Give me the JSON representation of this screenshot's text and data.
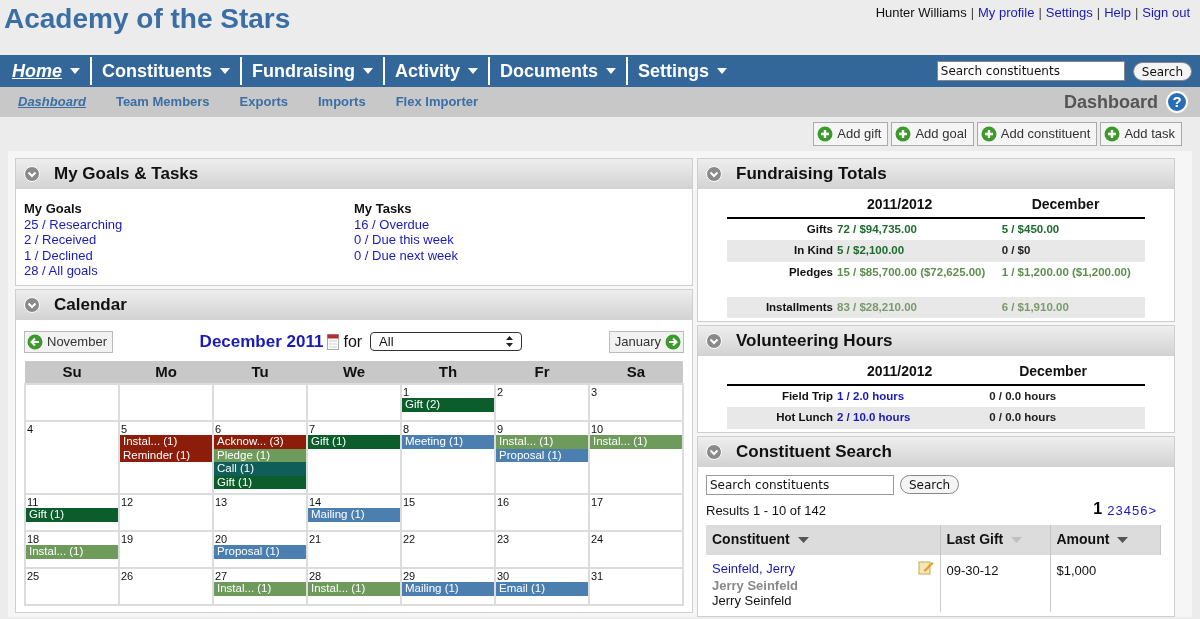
{
  "site_title": "Academy of the Stars",
  "user_bar": [
    {
      "kind": "text",
      "text": "Hunter Williams"
    },
    {
      "kind": "separator",
      "text": "|"
    },
    {
      "kind": "link",
      "text": "My profile"
    },
    {
      "kind": "separator",
      "text": "|"
    },
    {
      "kind": "link",
      "text": "Settings"
    },
    {
      "kind": "separator",
      "text": "|"
    },
    {
      "kind": "link",
      "text": "Help"
    },
    {
      "kind": "separator",
      "text": "|"
    },
    {
      "kind": "link",
      "text": "Sign out"
    }
  ],
  "nav": [
    {
      "label": "Home",
      "selected": true
    },
    {
      "label": "Constituents",
      "selected": false
    },
    {
      "label": "Fundraising",
      "selected": false
    },
    {
      "label": "Activity",
      "selected": false
    },
    {
      "label": "Documents",
      "selected": false
    },
    {
      "label": "Settings",
      "selected": false
    }
  ],
  "nav_search": {
    "value": "Search constituents",
    "button": "Search"
  },
  "subnav": [
    {
      "label": "Dashboard",
      "selected": true
    },
    {
      "label": "Team Members",
      "selected": false
    },
    {
      "label": "Exports",
      "selected": false
    },
    {
      "label": "Imports",
      "selected": false
    },
    {
      "label": "Flex Importer",
      "selected": false
    }
  ],
  "page_title": "Dashboard",
  "help_glyph": "?",
  "actions": [
    "Add gift",
    "Add goal",
    "Add constituent",
    "Add task"
  ],
  "goals_panel": {
    "title": "My Goals & Tasks",
    "goals": {
      "heading": "My Goals",
      "items": [
        "25 / Researching",
        "2 / Received",
        "1 / Declined",
        "28 / All goals"
      ]
    },
    "tasks": {
      "heading": "My Tasks",
      "items": [
        "16 / Overdue",
        "0 / Due this week",
        "0 / Due next week"
      ]
    }
  },
  "calendar": {
    "title": "Calendar",
    "prev": "November",
    "next": "January",
    "month": "December 2011",
    "for_label": "for",
    "filter": "All",
    "weekdays": [
      "Su",
      "Mo",
      "Tu",
      "We",
      "Th",
      "Fr",
      "Sa"
    ],
    "weeks": [
      [
        {
          "kind": "blank"
        },
        {
          "kind": "blank"
        },
        {
          "kind": "blank"
        },
        {
          "kind": "blank"
        },
        {
          "kind": "day",
          "day": "1",
          "events": [
            {
              "label": "Gift (2)",
              "color": "#0b5e2c"
            }
          ]
        },
        {
          "kind": "day",
          "day": "2"
        },
        {
          "kind": "day",
          "day": "3"
        }
      ],
      [
        {
          "kind": "day",
          "day": "4"
        },
        {
          "kind": "day",
          "day": "5",
          "events": [
            {
              "label": "Instal... (1)",
              "color": "#8b1d0a"
            },
            {
              "label": "Reminder (1)",
              "color": "#8b1d0a"
            }
          ]
        },
        {
          "kind": "day",
          "day": "6",
          "events": [
            {
              "label": "Acknow... (3)",
              "color": "#8b1d0a"
            },
            {
              "label": "Pledge (1)",
              "color": "#6e9a5c"
            },
            {
              "label": "Call (1)",
              "color": "#0f5e5a"
            },
            {
              "label": "Gift (1)",
              "color": "#0b5e2c"
            }
          ]
        },
        {
          "kind": "day",
          "day": "7",
          "events": [
            {
              "label": "Gift (1)",
              "color": "#0b5e2c"
            }
          ]
        },
        {
          "kind": "day",
          "day": "8",
          "events": [
            {
              "label": "Meeting (1)",
              "color": "#4a7fb0"
            }
          ]
        },
        {
          "kind": "day",
          "day": "9",
          "events": [
            {
              "label": "Instal... (1)",
              "color": "#6e9a5c"
            },
            {
              "label": "Proposal (1)",
              "color": "#4a7fb0"
            }
          ]
        },
        {
          "kind": "day",
          "day": "10",
          "events": [
            {
              "label": "Instal... (1)",
              "color": "#6e9a5c"
            }
          ]
        }
      ],
      [
        {
          "kind": "day",
          "day": "11",
          "events": [
            {
              "label": "Gift (1)",
              "color": "#0b5e2c"
            }
          ]
        },
        {
          "kind": "day",
          "day": "12"
        },
        {
          "kind": "day",
          "day": "13"
        },
        {
          "kind": "day",
          "day": "14",
          "events": [
            {
              "label": "Mailing (1)",
              "color": "#4a7fb0"
            }
          ]
        },
        {
          "kind": "day",
          "day": "15"
        },
        {
          "kind": "day",
          "day": "16"
        },
        {
          "kind": "day",
          "day": "17"
        }
      ],
      [
        {
          "kind": "day",
          "day": "18",
          "events": [
            {
              "label": "Instal... (1)",
              "color": "#6e9a5c"
            }
          ]
        },
        {
          "kind": "day",
          "day": "19"
        },
        {
          "kind": "day",
          "day": "20",
          "events": [
            {
              "label": "Proposal (1)",
              "color": "#4a7fb0"
            }
          ]
        },
        {
          "kind": "day",
          "day": "21"
        },
        {
          "kind": "day",
          "day": "22"
        },
        {
          "kind": "day",
          "day": "23"
        },
        {
          "kind": "day",
          "day": "24"
        }
      ],
      [
        {
          "kind": "day",
          "day": "25"
        },
        {
          "kind": "day",
          "day": "26"
        },
        {
          "kind": "day",
          "day": "27",
          "events": [
            {
              "label": "Instal... (1)",
              "color": "#6e9a5c"
            }
          ]
        },
        {
          "kind": "day",
          "day": "28",
          "events": [
            {
              "label": "Instal... (1)",
              "color": "#6e9a5c"
            }
          ]
        },
        {
          "kind": "day",
          "day": "29",
          "events": [
            {
              "label": "Mailing (1)",
              "color": "#4a7fb0"
            }
          ]
        },
        {
          "kind": "day",
          "day": "30",
          "events": [
            {
              "label": "Email (1)",
              "color": "#4a7fb0"
            }
          ]
        },
        {
          "kind": "day",
          "day": "31"
        }
      ]
    ]
  },
  "fundraising": {
    "title": "Fundraising Totals",
    "columns": [
      "2011/2012",
      "December"
    ],
    "rows": [
      {
        "label": "Gifts",
        "values": [
          {
            "text": "72 / $94,735.00",
            "color": "#1e6b2e"
          },
          {
            "text": "5 / $450.00",
            "color": "#1e6b2e"
          }
        ]
      },
      {
        "label": "In Kind",
        "values": [
          {
            "text": "5 / $2,100.00",
            "color": "#1e6b2e"
          },
          {
            "text": "0 / $0",
            "color": "#222222"
          }
        ]
      },
      {
        "label": "Pledges",
        "values": [
          {
            "text": "15 / $85,700.00 ($72,625.00)",
            "color": "#5f8f4e"
          },
          {
            "text": "1 / $1,200.00 ($1,200.00)",
            "color": "#5f8f4e"
          }
        ]
      },
      {
        "label": "Installments",
        "values": [
          {
            "text": "83 / $28,210.00",
            "color": "#7a9a6a"
          },
          {
            "text": "6 / $1,910.00",
            "color": "#7a9a6a"
          }
        ]
      }
    ]
  },
  "volunteering": {
    "title": "Volunteering Hours",
    "columns": [
      "2011/2012",
      "December"
    ],
    "rows": [
      {
        "label": "Field Trip",
        "values": [
          {
            "text": "1 / 2.0 hours",
            "color": "#1a1ab8"
          },
          {
            "text": "0 / 0.0 hours",
            "color": "#222222"
          }
        ]
      },
      {
        "label": "Hot Lunch",
        "values": [
          {
            "text": "2 / 10.0 hours",
            "color": "#1a1ab8"
          },
          {
            "text": "0 / 0.0 hours",
            "color": "#222222"
          }
        ]
      }
    ]
  },
  "constituent_search": {
    "title": "Constituent Search",
    "value": "Search constituents",
    "button": "Search",
    "results": "Results 1 - 10 of 142",
    "pages": [
      {
        "label": "1",
        "selected": true
      },
      {
        "label": "2",
        "selected": false
      },
      {
        "label": "3",
        "selected": false
      },
      {
        "label": "4",
        "selected": false
      },
      {
        "label": "5",
        "selected": false
      },
      {
        "label": "6",
        "selected": false
      },
      {
        "label": ">",
        "selected": false
      }
    ],
    "columns": [
      {
        "label": "Constituent",
        "sorted": true
      },
      {
        "label": "Last Gift",
        "sorted": false
      },
      {
        "label": "Amount",
        "sorted": true
      }
    ],
    "rows": [
      {
        "name": "Seinfeld, Jerry",
        "display_name": "Jerry Seinfeld",
        "contact": "Jerry Seinfeld",
        "last_gift": "09-30-12",
        "amount": "$1,000"
      }
    ]
  }
}
